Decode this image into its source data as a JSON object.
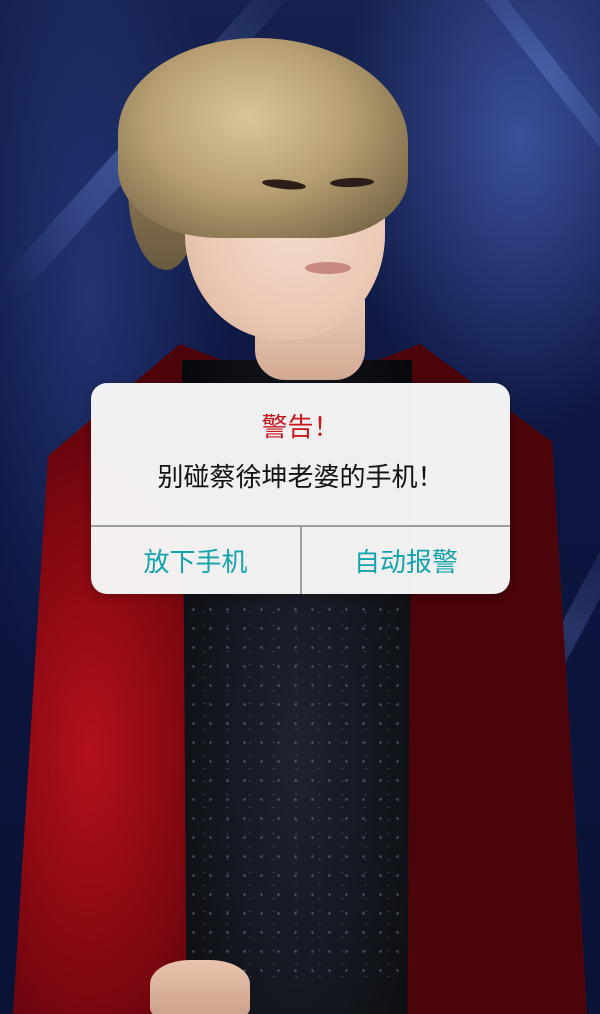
{
  "alert": {
    "title": "警告！",
    "message": "别碰蔡徐坤老婆的手机！",
    "buttons": {
      "left": "放下手机",
      "right": "自动报警"
    }
  },
  "colors": {
    "title": "#c8161d",
    "button_text": "#14a3ad",
    "dialog_bg": "#f8f8f8",
    "divider": "#9e9e9e"
  }
}
